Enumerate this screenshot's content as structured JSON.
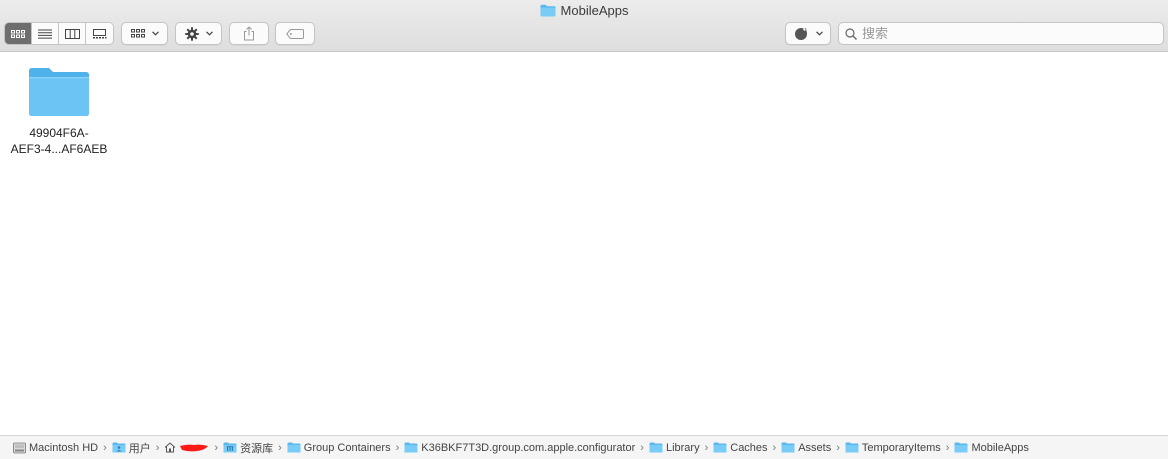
{
  "window": {
    "title": "MobileApps",
    "title_icon": "folder-icon"
  },
  "toolbar": {
    "view_modes": [
      {
        "name": "icon-view",
        "icon": "grid-icon",
        "active": true
      },
      {
        "name": "list-view",
        "icon": "list-icon",
        "active": false
      },
      {
        "name": "column-view",
        "icon": "columns-icon",
        "active": false
      },
      {
        "name": "gallery-view",
        "icon": "gallery-icon",
        "active": false
      }
    ],
    "group_icon": "group-grid-icon",
    "action_icon": "gear-icon",
    "share_icon": "share-icon",
    "tag_icon": "tag-icon",
    "tags_menu_icon": "tag-color-icon"
  },
  "search": {
    "placeholder": "搜索",
    "value": ""
  },
  "items": [
    {
      "line1": "49904F6A-",
      "line2": "AEF3-4...AF6AEB",
      "icon": "folder-icon"
    }
  ],
  "pathbar": {
    "crumbs": [
      {
        "label": "Macintosh HD",
        "icon": "hard-drive-icon"
      },
      {
        "label": "用户",
        "icon": "users-folder-icon"
      },
      {
        "label": "",
        "icon": "home-icon"
      },
      {
        "label": "资源库",
        "icon": "library-folder-icon"
      },
      {
        "label": "Group Containers",
        "icon": "folder-icon"
      },
      {
        "label": "K36BKF7T3D.group.com.apple.configurator",
        "icon": "folder-icon"
      },
      {
        "label": "Library",
        "icon": "folder-icon"
      },
      {
        "label": "Caches",
        "icon": "folder-icon"
      },
      {
        "label": "Assets",
        "icon": "folder-icon"
      },
      {
        "label": "TemporaryItems",
        "icon": "folder-icon"
      },
      {
        "label": "MobileApps",
        "icon": "folder-icon"
      }
    ],
    "separator": "›"
  },
  "colors": {
    "folder": "#6cc4f4",
    "folder_dark": "#4fb2ea",
    "redaction": "#ff1a1a"
  }
}
